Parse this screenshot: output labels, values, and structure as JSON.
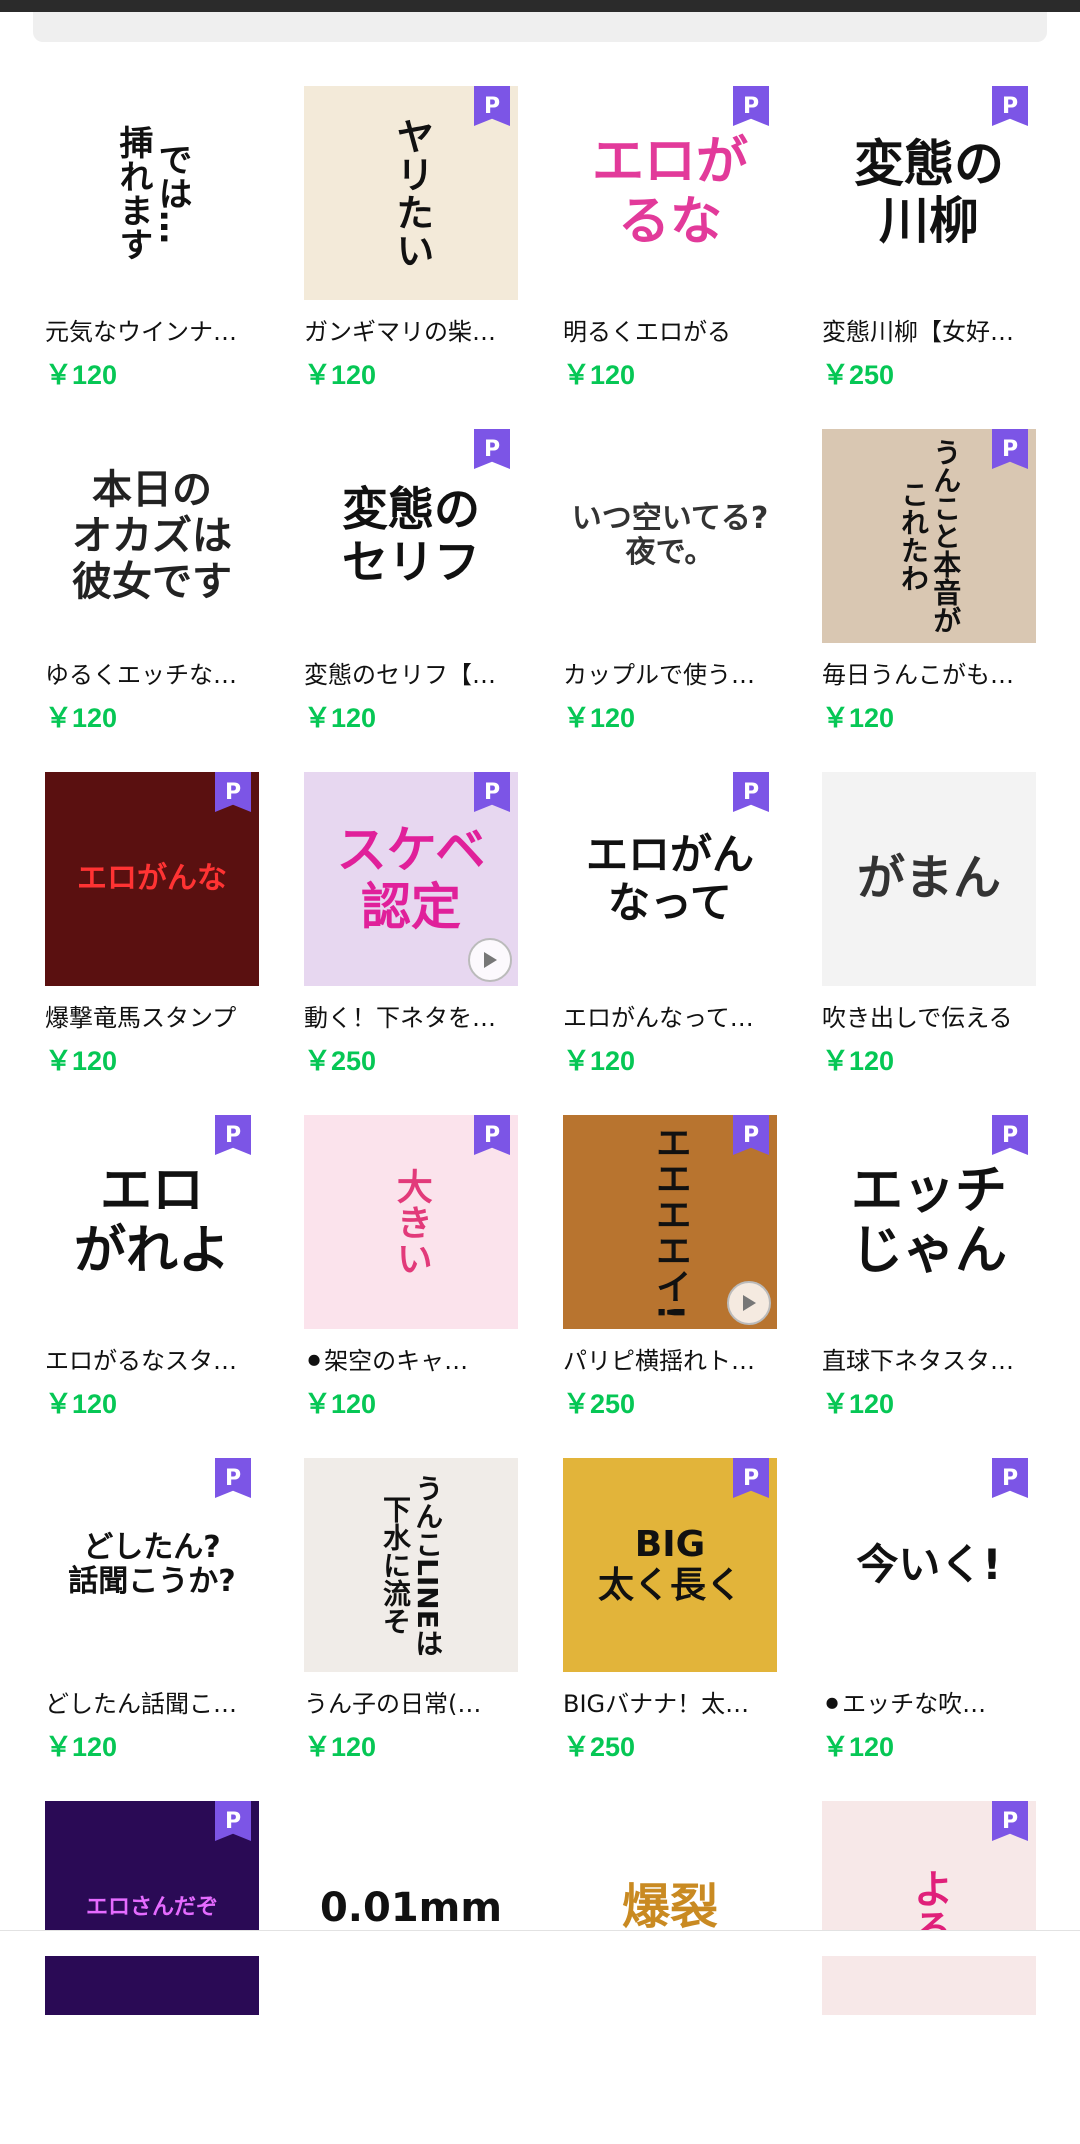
{
  "colors": {
    "price": "#06c755",
    "badge": "#7c55e6"
  },
  "items": [
    {
      "title": "元気なウインナ…",
      "price": "￥120",
      "badge": "",
      "thumb_text": "では…\n挿れます",
      "vertical": true,
      "thumb_bg": "#ffffff",
      "thumb_color": "#111111",
      "font": 34
    },
    {
      "title": "ガンギマリの柴…",
      "price": "￥120",
      "badge": "P",
      "thumb_text": "ヤリたい",
      "vertical": true,
      "thumb_bg": "#f3ead9",
      "thumb_color": "#111111",
      "font": 38
    },
    {
      "title": "明るくエロがる",
      "price": "￥120",
      "badge": "P",
      "thumb_text": "エロが\nるな",
      "vertical": false,
      "thumb_bg": "#ffffff",
      "thumb_color": "#e23a9a",
      "font": 52
    },
    {
      "title": "変態川柳【女好…",
      "price": "￥250",
      "badge": "P",
      "thumb_text": "変態の\n川柳",
      "vertical": false,
      "thumb_bg": "#ffffff",
      "thumb_color": "#111111",
      "font": 50
    },
    {
      "title": "ゆるくエッチな…",
      "price": "￥120",
      "badge": "",
      "thumb_text": "本日の\nオカズは\n彼女です",
      "vertical": false,
      "thumb_bg": "#ffffff",
      "thumb_color": "#222222",
      "font": 40
    },
    {
      "title": "変態のセリフ【…",
      "price": "￥120",
      "badge": "P",
      "thumb_text": "変態の\nセリフ",
      "vertical": false,
      "thumb_bg": "#ffffff",
      "thumb_color": "#111111",
      "font": 46
    },
    {
      "title": "カップルで使う…",
      "price": "￥120",
      "badge": "",
      "thumb_text": "いつ空いてる?\n夜で。",
      "vertical": false,
      "thumb_bg": "#ffffff",
      "thumb_color": "#333333",
      "font": 30
    },
    {
      "title": "毎日うんこがも…",
      "price": "￥120",
      "badge": "P",
      "thumb_text": "うんこと本音が\nこれたわ",
      "vertical": true,
      "thumb_bg": "#d9c7b2",
      "thumb_color": "#111111",
      "font": 28
    },
    {
      "title": "爆撃竜馬スタンプ",
      "price": "￥120",
      "badge": "P",
      "thumb_text": "エロがんな",
      "vertical": false,
      "thumb_bg": "#5a1010",
      "thumb_color": "#ff3333",
      "font": 30
    },
    {
      "title": "動く！下ネタを…",
      "price": "￥250",
      "badge": "P",
      "thumb_text": "スケベ\n認定",
      "vertical": false,
      "thumb_bg": "#e7d7f0",
      "thumb_color": "#e0209a",
      "font": 50,
      "play": true
    },
    {
      "title": "エロがんなって…",
      "price": "￥120",
      "badge": "P",
      "thumb_text": "エロがん\nなって",
      "vertical": false,
      "thumb_bg": "#ffffff",
      "thumb_color": "#111111",
      "font": 42
    },
    {
      "title": "吹き出しで伝える",
      "price": "￥120",
      "badge": "",
      "thumb_text": "がまん",
      "vertical": false,
      "thumb_bg": "#f3f3f3",
      "thumb_color": "#333333",
      "font": 48
    },
    {
      "title": "エロがるなスタ…",
      "price": "￥120",
      "badge": "P",
      "thumb_text": "エロ\nがれよ",
      "vertical": false,
      "thumb_bg": "#ffffff",
      "thumb_color": "#111111",
      "font": 52
    },
    {
      "title": "⚫架空のキャ…",
      "price": "￥120",
      "badge": "P",
      "thumb_text": "大きい",
      "vertical": true,
      "thumb_bg": "#fbe3ec",
      "thumb_color": "#e23a7a",
      "font": 36
    },
    {
      "title": "パリピ横揺れト…",
      "price": "￥250",
      "badge": "P",
      "thumb_text": "エエエエイ!",
      "vertical": true,
      "thumb_bg": "#b8742f",
      "thumb_color": "#111111",
      "font": 36,
      "play": true
    },
    {
      "title": "直球下ネタスタ…",
      "price": "￥120",
      "badge": "P",
      "thumb_text": "エッチ\nじゃん",
      "vertical": false,
      "thumb_bg": "#ffffff",
      "thumb_color": "#111111",
      "font": 52
    },
    {
      "title": "どしたん話聞こ…",
      "price": "￥120",
      "badge": "P",
      "thumb_text": "どしたん?\n話聞こうか?",
      "vertical": false,
      "thumb_bg": "#ffffff",
      "thumb_color": "#111111",
      "font": 30
    },
    {
      "title": "うん子の日常(…",
      "price": "￥120",
      "badge": "",
      "thumb_text": "うんこLINEは\n下水に流そ",
      "vertical": true,
      "thumb_bg": "#f0ece8",
      "thumb_color": "#111111",
      "font": 28
    },
    {
      "title": "BIGバナナ！太…",
      "price": "￥250",
      "badge": "P",
      "thumb_text": "BIG\n太く長く",
      "vertical": false,
      "thumb_bg": "#e2b43a",
      "thumb_color": "#111111",
      "font": 36
    },
    {
      "title": "⚫エッチな吹…",
      "price": "￥120",
      "badge": "P",
      "thumb_text": "今いく!",
      "vertical": false,
      "thumb_bg": "#ffffff",
      "thumb_color": "#111111",
      "font": 42
    },
    {
      "title": "",
      "price": "",
      "badge": "P",
      "thumb_text": "エロさんだぞ",
      "vertical": false,
      "thumb_bg": "#2a0a55",
      "thumb_color": "#e56bff",
      "font": 22
    },
    {
      "title": "",
      "price": "",
      "badge": "",
      "thumb_text": "0.01mm",
      "vertical": false,
      "thumb_bg": "#ffffff",
      "thumb_color": "#111111",
      "font": 40
    },
    {
      "title": "",
      "price": "",
      "badge": "",
      "thumb_text": "爆裂",
      "vertical": false,
      "thumb_bg": "#ffffff",
      "thumb_color": "#c98a22",
      "font": 48
    },
    {
      "title": "",
      "price": "",
      "badge": "P",
      "thumb_text": "よろ",
      "vertical": true,
      "thumb_bg": "#f7e8e8",
      "thumb_color": "#e0207a",
      "font": 40
    }
  ]
}
